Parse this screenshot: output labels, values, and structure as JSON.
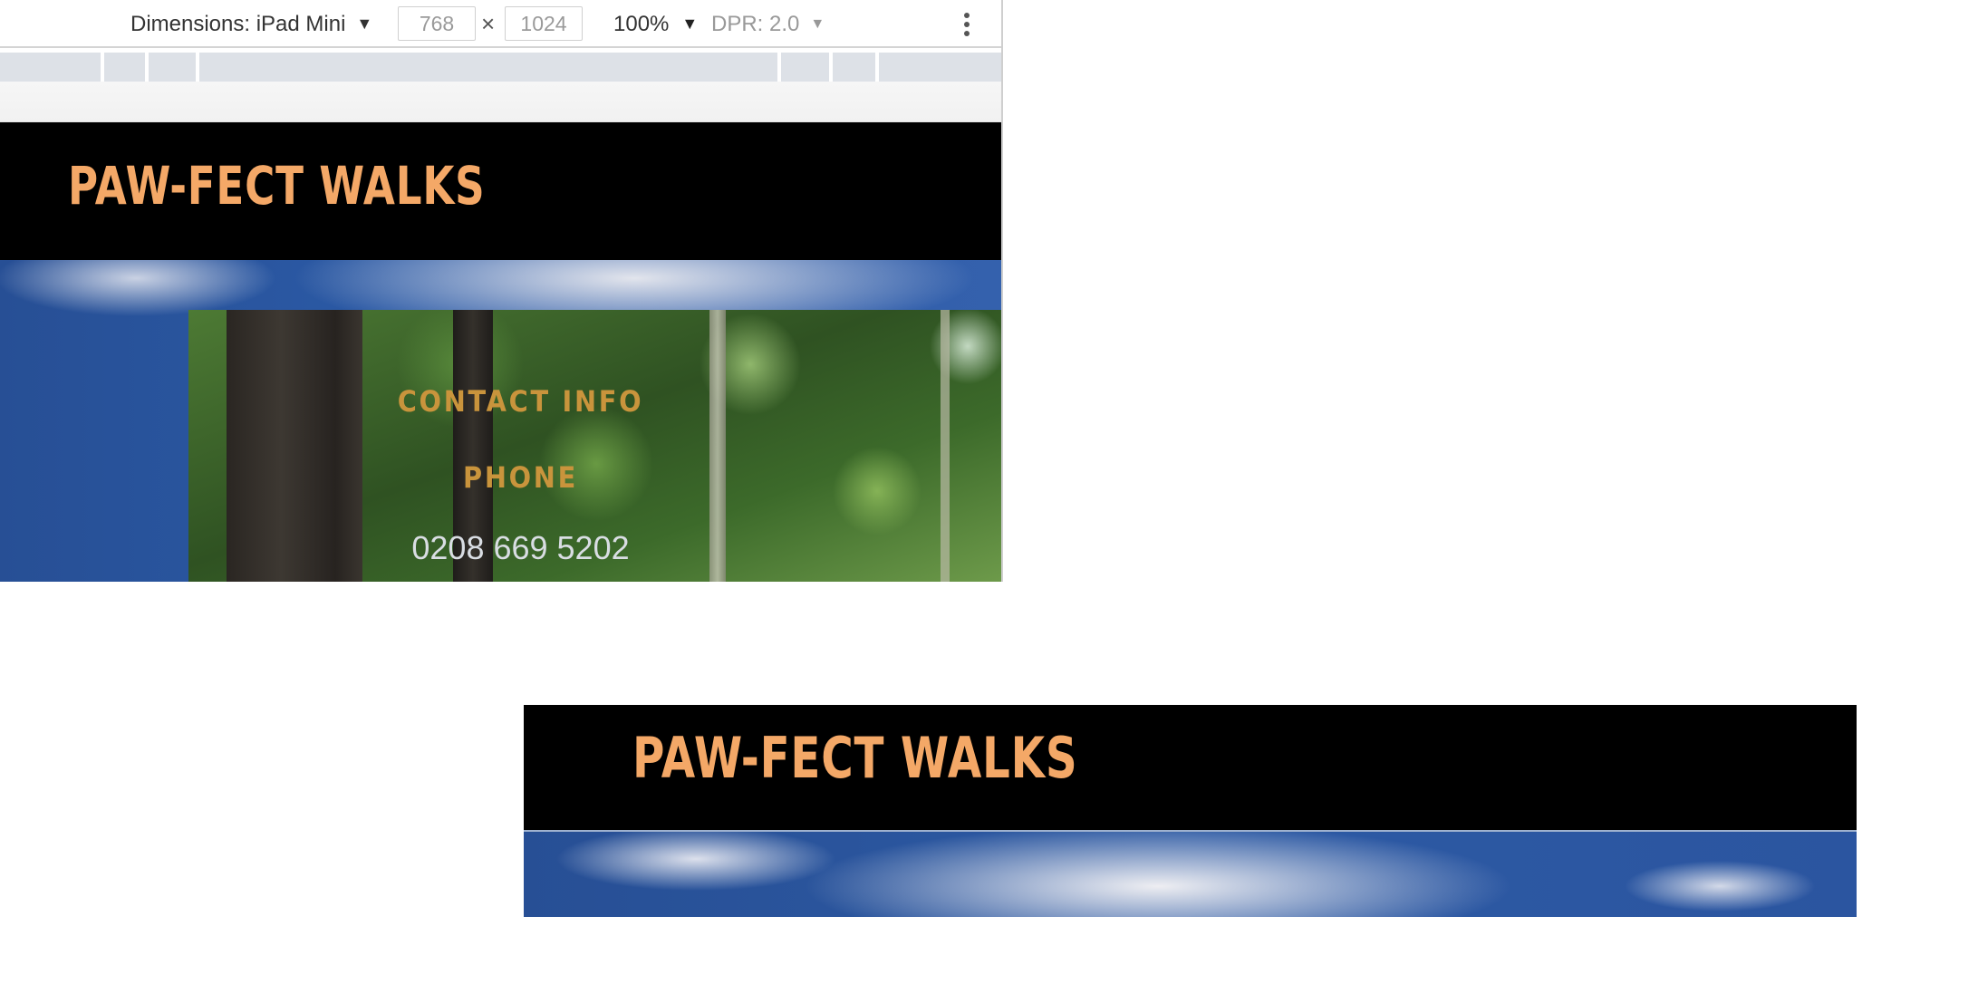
{
  "toolbar": {
    "dimensions_label": "Dimensions: iPad Mini",
    "width_value": "768",
    "height_value": "1024",
    "times_sign": "×",
    "zoom_label": "100%",
    "dpr_label": "DPR: 2.0",
    "caret_icon": "▼"
  },
  "site": {
    "brand": "PAW-FECT WALKS",
    "contact_heading": "CONTACT INFO",
    "phone_heading": "PHONE",
    "phone_number": "0208 669 5202"
  },
  "preview": {
    "brand": "PAW-FECT WALKS"
  },
  "colors": {
    "brand_orange": "#f4a867",
    "heading_gold": "#c9943c",
    "header_black": "#000000",
    "sky_blue": "#2b5aa6"
  }
}
